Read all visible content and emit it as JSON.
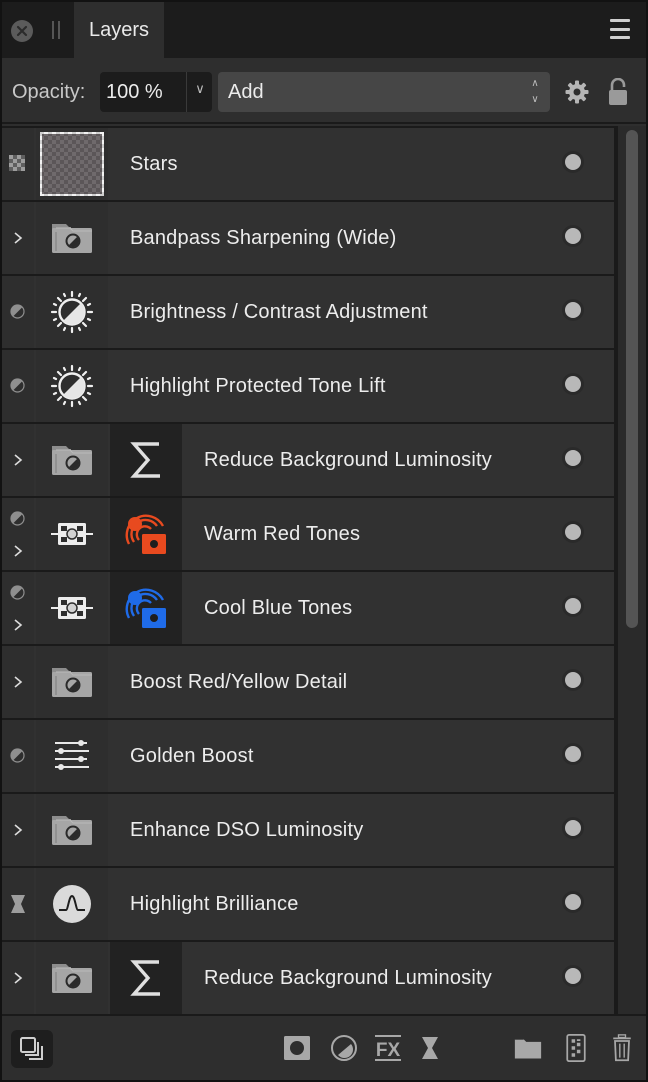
{
  "titlebar": {
    "tab_label": "Layers",
    "close_icon": "close-icon",
    "menu_icon": "hamburger-menu-icon"
  },
  "toolbar": {
    "opacity_label": "Opacity:",
    "opacity_value": "100 %",
    "blend_mode": "Add",
    "settings_icon": "gear-icon",
    "lock_icon": "lock-open-icon"
  },
  "layers": [
    {
      "name": "Stars",
      "left_icon": "pixel-layer-icon",
      "thumb": "transparent-thumbnail",
      "visible": true
    },
    {
      "name": "Bandpass Sharpening (Wide)",
      "left_icon": "expand-chevron-icon",
      "thumb": "group-folder-icon",
      "visible": true
    },
    {
      "name": "Brightness / Contrast Adjustment",
      "left_icon": "adjustment-icon",
      "thumb": "brightness-contrast-icon",
      "visible": true
    },
    {
      "name": "Highlight Protected Tone Lift",
      "left_icon": "adjustment-icon",
      "thumb": "brightness-contrast-icon",
      "visible": true
    },
    {
      "name": "Reduce Background Luminosity",
      "left_icon": "expand-chevron-icon",
      "thumb": "group-folder-icon",
      "thumb2": "sigma-icon",
      "visible": true
    },
    {
      "name": "Warm Red Tones",
      "left_icon": "adjustment-expand-icon",
      "thumb": "selective-color-icon",
      "thumb2": "color-picker-red-icon",
      "accent": "#e84a1f",
      "visible": true
    },
    {
      "name": "Cool Blue Tones",
      "left_icon": "adjustment-expand-icon",
      "thumb": "selective-color-icon",
      "thumb2": "color-picker-blue-icon",
      "accent": "#1f6be8",
      "visible": true
    },
    {
      "name": "Boost Red/Yellow Detail",
      "left_icon": "expand-chevron-icon",
      "thumb": "group-folder-icon",
      "visible": true
    },
    {
      "name": "Golden Boost",
      "left_icon": "adjustment-icon",
      "thumb": "levels-sliders-icon",
      "visible": true
    },
    {
      "name": "Enhance DSO Luminosity",
      "left_icon": "expand-chevron-icon",
      "thumb": "group-folder-icon",
      "visible": true
    },
    {
      "name": "Highlight Brilliance",
      "left_icon": "live-filter-icon",
      "thumb": "curve-peak-icon",
      "visible": true
    },
    {
      "name": "Reduce Background Luminosity",
      "left_icon": "expand-chevron-icon",
      "thumb": "group-folder-icon",
      "thumb2": "sigma-icon",
      "visible": true
    }
  ],
  "bottombar": {
    "buttons": [
      "layers-stack-icon",
      "mask-layer-icon",
      "adjustment-icon",
      "fx-icon",
      "live-filter-icon",
      "group-folder-icon",
      "pixel-layer-icon",
      "trash-icon"
    ]
  }
}
